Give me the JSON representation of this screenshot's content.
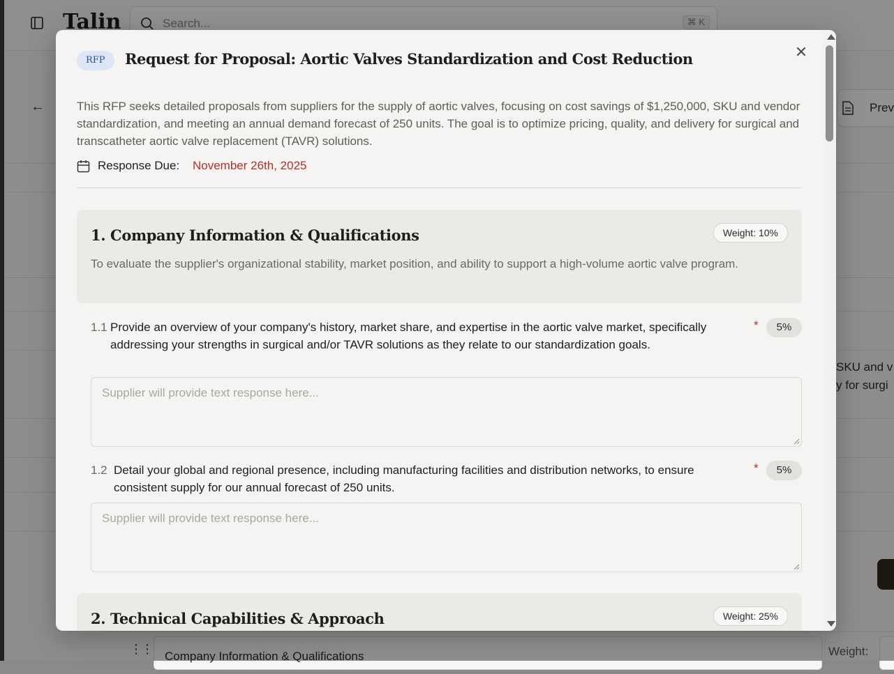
{
  "app": {
    "logo": "Talin",
    "search_placeholder": "Search...",
    "search_shortcut": "⌘ K",
    "preview_label": "Prev",
    "side_text_line1": "SKU and v",
    "side_text_line2": "y for surgi",
    "bottom_section_name": "Company Information & Qualifications",
    "bottom_weight_label": "Weight:"
  },
  "modal": {
    "badge": "RFP",
    "title": "Request for Proposal: Aortic Valves Standardization and Cost Reduction",
    "description": "This RFP seeks detailed proposals from suppliers for the supply of aortic valves, focusing on cost savings of $1,250,000, SKU and vendor standardization, and meeting an annual demand forecast of 250 units. The goal is to optimize pricing, quality, and delivery for surgical and transcatheter aortic valve replacement (TAVR) solutions.",
    "due_label": "Response Due:",
    "due_date": "November 26th, 2025"
  },
  "sections": [
    {
      "title": "1. Company Information & Qualifications",
      "weight": "Weight: 10%",
      "description": "To evaluate the supplier's organizational stability, market position, and ability to support a high-volume aortic valve program.",
      "questions": [
        {
          "number": "1.1",
          "text": "Provide an overview of your company's history, market share, and expertise in the aortic valve market, specifically addressing your strengths in surgical and/or TAVR solutions as they relate to our standardization goals.",
          "required": "*",
          "weight": "5%",
          "placeholder": "Supplier will provide text response here..."
        },
        {
          "number": "1.2",
          "text": "Detail your global and regional presence, including manufacturing facilities and distribution networks, to ensure consistent supply for our annual forecast of 250 units.",
          "required": "*",
          "weight": "5%",
          "placeholder": "Supplier will provide text response here..."
        }
      ]
    },
    {
      "title": "2. Technical Capabilities & Approach",
      "weight": "Weight: 25%"
    }
  ],
  "colors": {
    "accent_red": "#b3302b",
    "badge_bg": "#dde6f6",
    "badge_text": "#2f4e8f"
  }
}
